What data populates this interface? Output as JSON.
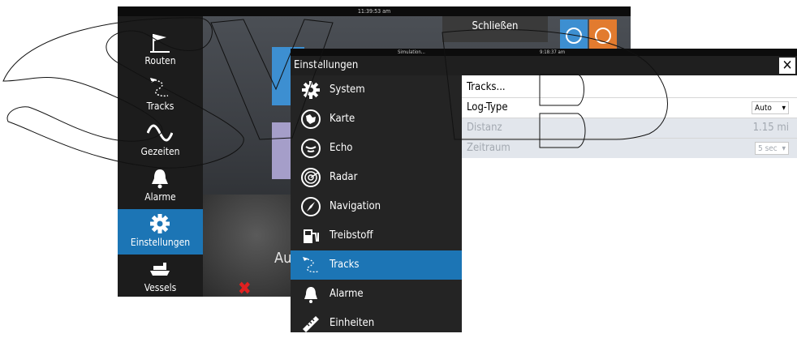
{
  "back": {
    "time": "11:39:53 am",
    "close_label": "Schließen",
    "partial_text": "Au",
    "nav": [
      {
        "label": "Routen",
        "icon": "route-flag-icon"
      },
      {
        "label": "Tracks",
        "icon": "tracks-icon"
      },
      {
        "label": "Gezeiten",
        "icon": "tide-wave-icon"
      },
      {
        "label": "Alarme",
        "icon": "bell-icon"
      },
      {
        "label": "Einstellungen",
        "icon": "gear-icon"
      },
      {
        "label": "Vessels",
        "icon": "vessel-icon"
      }
    ],
    "active_nav": "Einstellungen",
    "colors": {
      "accent": "#1c75b5",
      "tile_blue": "#3d8fd1",
      "tile_purple": "#a59ec9"
    }
  },
  "dialog": {
    "status_left": "Simulation...",
    "status_time": "9:18:37 am",
    "title": "Einstellungen",
    "close_icon": "close-icon",
    "sidebar": [
      {
        "label": "System",
        "icon": "gear-icon"
      },
      {
        "label": "Karte",
        "icon": "chart-map-icon"
      },
      {
        "label": "Echo",
        "icon": "echo-sonar-icon"
      },
      {
        "label": "Radar",
        "icon": "radar-icon"
      },
      {
        "label": "Navigation",
        "icon": "compass-icon"
      },
      {
        "label": "Treibstoff",
        "icon": "fuel-pump-icon"
      },
      {
        "label": "Tracks",
        "icon": "tracks-icon"
      },
      {
        "label": "Alarme",
        "icon": "bell-icon"
      },
      {
        "label": "Einheiten",
        "icon": "ruler-icon"
      }
    ],
    "active_item": "Tracks",
    "panel": {
      "tracks_link": "Tracks...",
      "log_type_label": "Log-Type",
      "log_type_value": "Auto",
      "distance_label": "Distanz",
      "distance_value": "1.15 mi",
      "period_label": "Zeitraum",
      "period_value": "5 sec"
    }
  }
}
